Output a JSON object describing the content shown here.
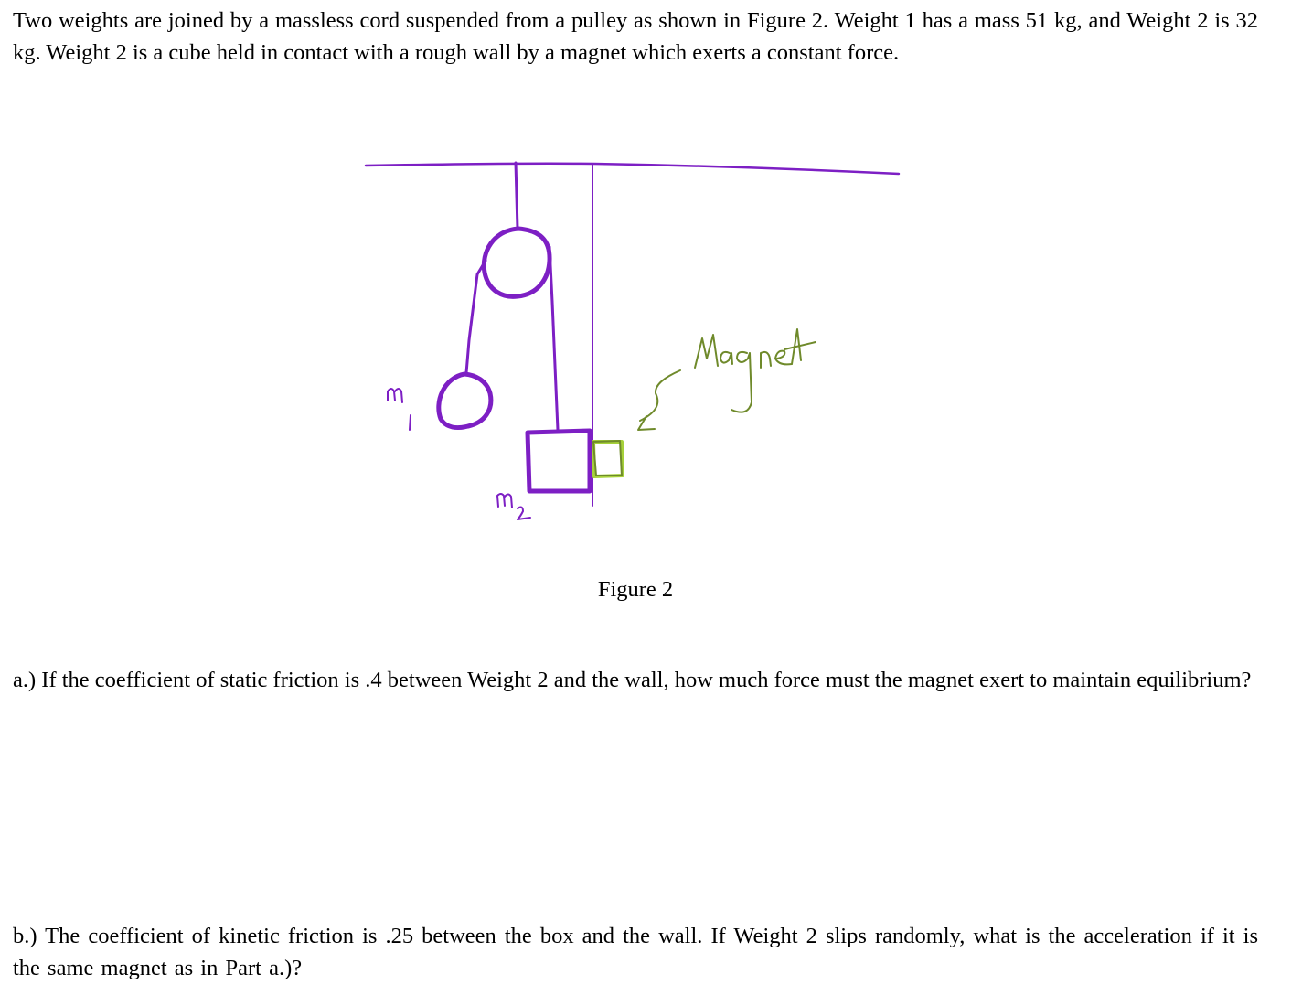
{
  "problem": {
    "intro": "Two weights are joined by a massless cord suspended from a pulley as shown in Figure 2.  Weight 1 has a mass 51 kg, and Weight 2 is 32 kg.  Weight 2 is a cube held in contact with a rough wall by a magnet which exerts a constant force.",
    "figure": {
      "caption": "Figure 2",
      "label_m1": "m1",
      "label_m2": "m2",
      "label_magnet": "Magnet",
      "colors": {
        "drawing": "#7d1fc4",
        "magnet": "#6f8a2b",
        "magnet_highlight": "#a6d13a"
      }
    },
    "part_a": "a.) If the coefficient of static friction is .4 between Weight 2 and the wall, how much force must the magnet exert to maintain equilibrium?",
    "part_b": "b.)  The coefficient of kinetic friction is .25 between the box and the wall.  If Weight 2 slips randomly, what is the acceleration if it is the same magnet as in Part a.)?"
  }
}
